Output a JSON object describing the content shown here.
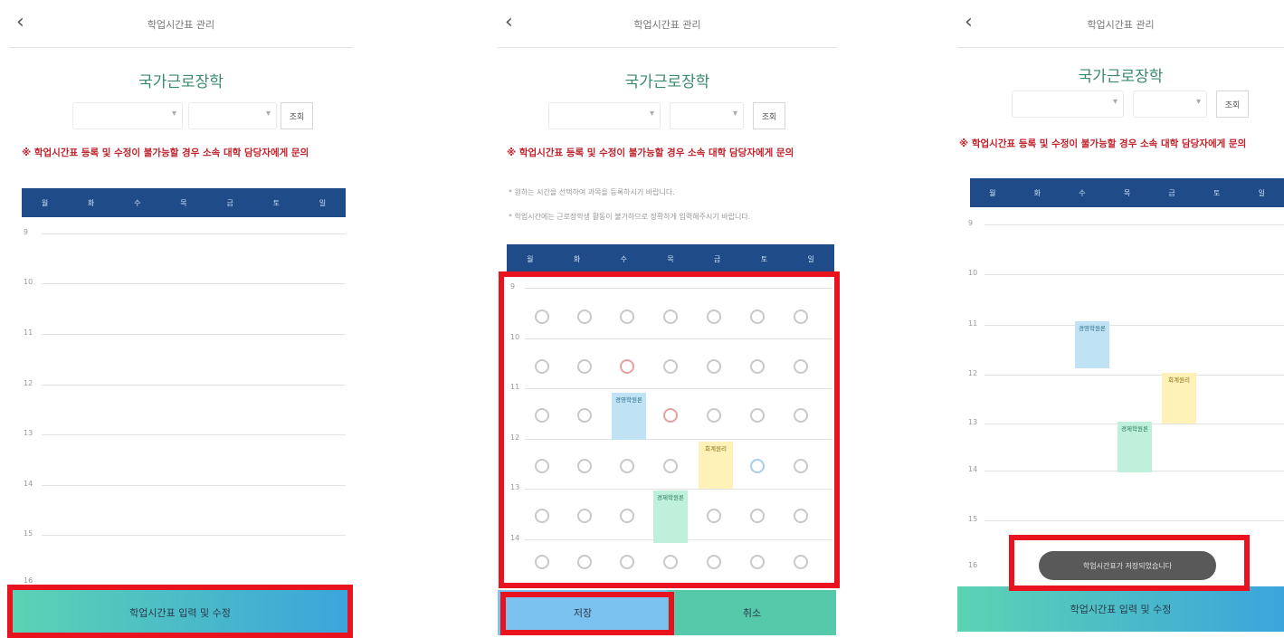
{
  "panels": [
    {
      "header_title": "학업시간표 관리",
      "page_title": "국가근로장학",
      "search_label": "조회",
      "notice": "※ 학업시간표 등록 및 수정이 불가능할 경우 소속 대학 담당자에게 문의",
      "days": [
        "월",
        "화",
        "수",
        "목",
        "금",
        "토",
        "일"
      ],
      "hours": [
        "9",
        "10",
        "11",
        "12",
        "13",
        "14",
        "15",
        "16"
      ],
      "bottom_button": "학업시간표 입력 및 수정"
    },
    {
      "header_title": "학업시간표 관리",
      "page_title": "국가근로장학",
      "search_label": "조회",
      "notice": "※ 학업시간표 등록 및 수정이 불가능할 경우 소속 대학 담당자에게 문의",
      "notes": [
        "* 원하는 시간을 선택하여 과목을 등록하시기 바랍니다.",
        "* 학업시간에는 근로장학생 활동이 불가하므로 정확하게 입력해주시기 바랍니다."
      ],
      "days": [
        "월",
        "화",
        "수",
        "목",
        "금",
        "토",
        "일"
      ],
      "hours": [
        "9",
        "10",
        "11",
        "12",
        "13",
        "14"
      ],
      "courses": [
        {
          "name": "경영학원론"
        },
        {
          "name": "회계원리"
        },
        {
          "name": "경제학원론"
        }
      ],
      "confirm_button": "저장",
      "cancel_button": "취소"
    },
    {
      "header_title": "학업시간표 관리",
      "page_title": "국가근로장학",
      "search_label": "조회",
      "notice": "※ 학업시간표 등록 및 수정이 불가능할 경우 소속 대학 담당자에게 문의",
      "days": [
        "월",
        "화",
        "수",
        "목",
        "금",
        "토",
        "일"
      ],
      "hours": [
        "9",
        "10",
        "11",
        "12",
        "13",
        "14",
        "15",
        "16"
      ],
      "courses": [
        {
          "name": "경영학원론"
        },
        {
          "name": "회계원리"
        },
        {
          "name": "경제학원론"
        }
      ],
      "toast": "학업시간표가 저장되었습니다",
      "bottom_button": "학업시간표 입력 및 수정"
    }
  ],
  "colors": {
    "title_green": "#3a8a6e",
    "notice_red": "#c0212a",
    "day_header_navy": "#1f4c88",
    "bottom_gradient_start": "#5cd3b3",
    "bottom_gradient_end": "#3aa5dc",
    "highlight_red": "#e8131e"
  },
  "icons": {
    "back": "chevron-left-icon",
    "dropdown": "chevron-down-icon"
  }
}
